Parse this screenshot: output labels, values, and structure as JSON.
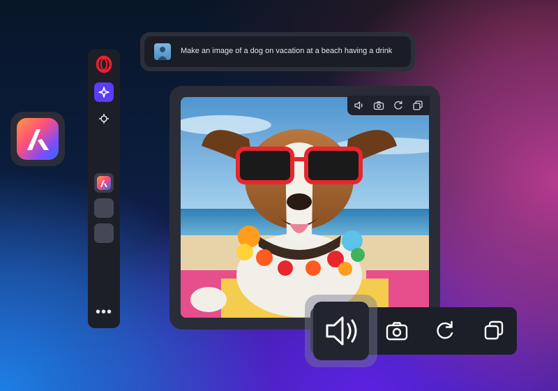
{
  "prompt": {
    "text": "Make an image of a dog on vacation at a beach having a drink"
  },
  "sidebar": {
    "items": [
      {
        "name": "opera-logo-icon"
      },
      {
        "name": "aria-sparkle-icon"
      },
      {
        "name": "crosshair-icon"
      },
      {
        "name": "app-thumbnail-icon"
      },
      {
        "name": "empty-slot"
      },
      {
        "name": "empty-slot"
      }
    ],
    "more": "•••"
  },
  "image_toolbar": {
    "buttons": [
      "speaker-icon",
      "camera-icon",
      "refresh-icon",
      "copy-icon"
    ]
  },
  "colors": {
    "accent": "#5a3df5",
    "panel": "#1f222c",
    "opera_red": "#ff1b2d"
  }
}
